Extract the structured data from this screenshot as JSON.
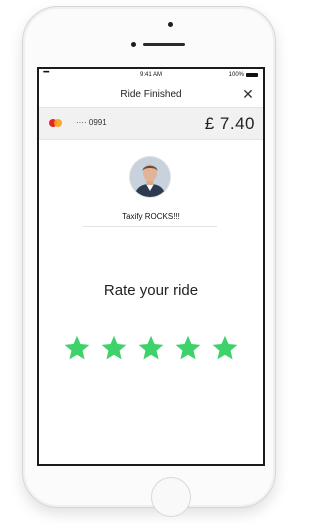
{
  "status_bar": {
    "signal": "•••••",
    "time": "9:41 AM",
    "battery_percent": "100%"
  },
  "nav": {
    "title": "Ride Finished",
    "close_icon": "close-icon"
  },
  "payment": {
    "card_icon": "mastercard-icon",
    "card_number": "···· 0991",
    "fare": "£ 7.40"
  },
  "driver": {
    "avatar_icon": "driver-avatar",
    "message": "Taxify ROCKS!!!"
  },
  "rating": {
    "title": "Rate your ride",
    "stars_max": 5,
    "stars_selected": 5,
    "star_color": "#3ed36a"
  },
  "colors": {
    "accent_green": "#3ed36a",
    "payment_bg": "#f1f1f1"
  }
}
